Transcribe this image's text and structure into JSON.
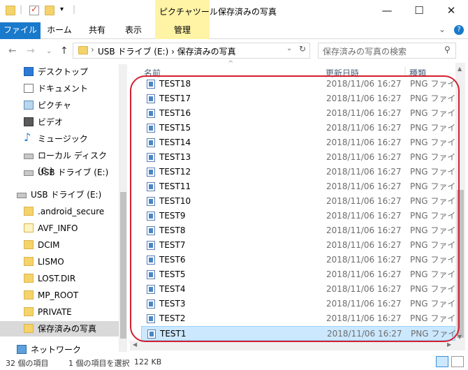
{
  "title_bar": {
    "context_tab_title": "ピクチャツール",
    "window_title": "保存済みの写真",
    "minimize": "—",
    "maximize": "☐",
    "close": "✕"
  },
  "ribbon": {
    "tabs": [
      "ファイル",
      "ホーム",
      "共有",
      "表示",
      "管理"
    ],
    "expand": "⌄",
    "help": "?"
  },
  "address": {
    "path": "USB ドライブ (E:)  ›  保存済みの写真",
    "search_placeholder": "保存済みの写真の検索"
  },
  "nav_pane": {
    "items": [
      {
        "label": "デスクトップ",
        "icon": "desktop-icon"
      },
      {
        "label": "ドキュメント",
        "icon": "documents-icon"
      },
      {
        "label": "ピクチャ",
        "icon": "pictures-icon"
      },
      {
        "label": "ビデオ",
        "icon": "video-icon"
      },
      {
        "label": "ミュージック",
        "icon": "music-icon"
      },
      {
        "label": "ローカル ディスク (C:)",
        "icon": "local-disk-icon"
      },
      {
        "label": "USB ドライブ (E:)",
        "icon": "usb-drive-icon"
      },
      {
        "label": "USB ドライブ (E:)",
        "icon": "usb-drive-icon"
      },
      {
        "label": ".android_secure",
        "icon": "folder-icon"
      },
      {
        "label": "AVF_INFO",
        "icon": "folder-icon"
      },
      {
        "label": "DCIM",
        "icon": "folder-icon"
      },
      {
        "label": "LISMO",
        "icon": "folder-icon"
      },
      {
        "label": "LOST.DIR",
        "icon": "folder-icon"
      },
      {
        "label": "MP_ROOT",
        "icon": "folder-icon"
      },
      {
        "label": "PRIVATE",
        "icon": "folder-icon"
      },
      {
        "label": "保存済みの写真",
        "icon": "folder-icon"
      },
      {
        "label": "ネットワーク",
        "icon": "network-icon"
      }
    ]
  },
  "columns": {
    "name": "名前",
    "date": "更新日時",
    "type": "種類"
  },
  "files": [
    {
      "name": "TEST18",
      "date": "2018/11/06 16:27",
      "type": "PNG ファイル"
    },
    {
      "name": "TEST17",
      "date": "2018/11/06 16:27",
      "type": "PNG ファイル"
    },
    {
      "name": "TEST16",
      "date": "2018/11/06 16:27",
      "type": "PNG ファイル"
    },
    {
      "name": "TEST15",
      "date": "2018/11/06 16:27",
      "type": "PNG ファイル"
    },
    {
      "name": "TEST14",
      "date": "2018/11/06 16:27",
      "type": "PNG ファイル"
    },
    {
      "name": "TEST13",
      "date": "2018/11/06 16:27",
      "type": "PNG ファイル"
    },
    {
      "name": "TEST12",
      "date": "2018/11/06 16:27",
      "type": "PNG ファイル"
    },
    {
      "name": "TEST11",
      "date": "2018/11/06 16:27",
      "type": "PNG ファイル"
    },
    {
      "name": "TEST10",
      "date": "2018/11/06 16:27",
      "type": "PNG ファイル"
    },
    {
      "name": "TEST9",
      "date": "2018/11/06 16:27",
      "type": "PNG ファイル"
    },
    {
      "name": "TEST8",
      "date": "2018/11/06 16:27",
      "type": "PNG ファイル"
    },
    {
      "name": "TEST7",
      "date": "2018/11/06 16:27",
      "type": "PNG ファイル"
    },
    {
      "name": "TEST6",
      "date": "2018/11/06 16:27",
      "type": "PNG ファイル"
    },
    {
      "name": "TEST5",
      "date": "2018/11/06 16:27",
      "type": "PNG ファイル"
    },
    {
      "name": "TEST4",
      "date": "2018/11/06 16:27",
      "type": "PNG ファイル"
    },
    {
      "name": "TEST3",
      "date": "2018/11/06 16:27",
      "type": "PNG ファイル"
    },
    {
      "name": "TEST2",
      "date": "2018/11/06 16:27",
      "type": "PNG ファイル"
    },
    {
      "name": "TEST1",
      "date": "2018/11/06 16:27",
      "type": "PNG ファイル"
    }
  ],
  "status": {
    "count": "32 個の項目",
    "selected": "1 個の項目を選択",
    "size": "122 KB"
  },
  "colors": {
    "file_tab": "#1979ca",
    "context_tab": "#fff3a6",
    "selection": "#cce8ff",
    "annotation_circle": "#d22030"
  }
}
